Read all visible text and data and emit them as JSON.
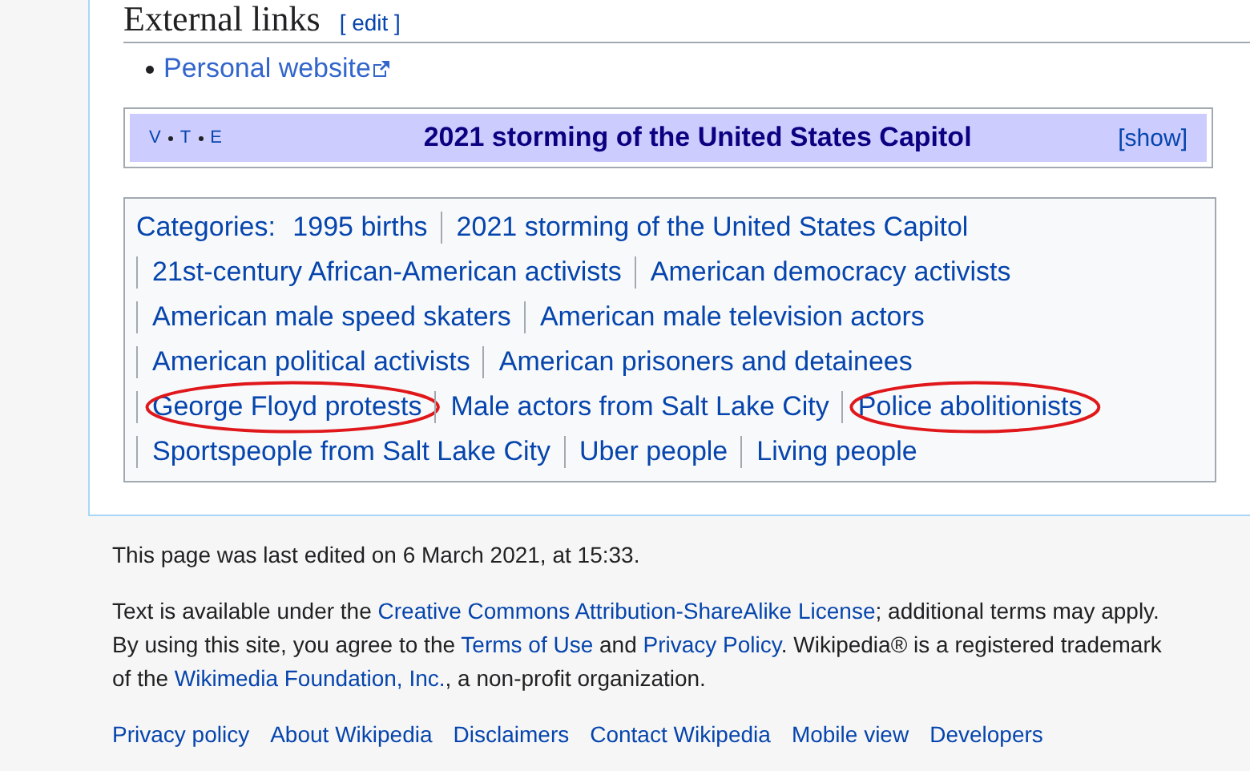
{
  "section": {
    "heading": "External links",
    "edit_link": "[ edit ]"
  },
  "external_links": [
    {
      "label": "Personal website"
    }
  ],
  "navbox": {
    "links": [
      "V",
      "T",
      "E"
    ],
    "title": "2021 storming of the United States Capitol",
    "toggle": "[show]"
  },
  "categories": {
    "label": "Categories:",
    "items": [
      {
        "label": "1995 births",
        "circled": false
      },
      {
        "label": "2021 storming of the United States Capitol",
        "circled": false
      },
      {
        "label": "21st-century African-American activists",
        "circled": false
      },
      {
        "label": "American democracy activists",
        "circled": false
      },
      {
        "label": "American male speed skaters",
        "circled": false
      },
      {
        "label": "American male television actors",
        "circled": false
      },
      {
        "label": "American political activists",
        "circled": false
      },
      {
        "label": "American prisoners and detainees",
        "circled": false
      },
      {
        "label": "George Floyd protests",
        "circled": true
      },
      {
        "label": "Male actors from Salt Lake City",
        "circled": false
      },
      {
        "label": "Police abolitionists",
        "circled": true
      },
      {
        "label": "Sportspeople from Salt Lake City",
        "circled": false
      },
      {
        "label": "Uber people",
        "circled": false
      },
      {
        "label": "Living people",
        "circled": false
      }
    ]
  },
  "footer": {
    "last_edited": "This page was last edited on 6 March 2021, at 15:33.",
    "license": [
      {
        "kind": "text",
        "text": "Text is available under the "
      },
      {
        "kind": "link",
        "text": "Creative Commons Attribution-ShareAlike License"
      },
      {
        "kind": "text",
        "text": "; additional terms may apply. By using this site, you agree to the "
      },
      {
        "kind": "link",
        "text": "Terms of Use"
      },
      {
        "kind": "text",
        "text": " and "
      },
      {
        "kind": "link",
        "text": "Privacy Policy"
      },
      {
        "kind": "text",
        "text": ". Wikipedia® is a registered trademark of the "
      },
      {
        "kind": "link",
        "text": "Wikimedia Foundation, Inc."
      },
      {
        "kind": "text",
        "text": ", a non-profit organization."
      }
    ],
    "links": [
      "Privacy policy",
      "About Wikipedia",
      "Disclaimers",
      "Contact Wikipedia",
      "Mobile view",
      "Developers"
    ]
  }
}
